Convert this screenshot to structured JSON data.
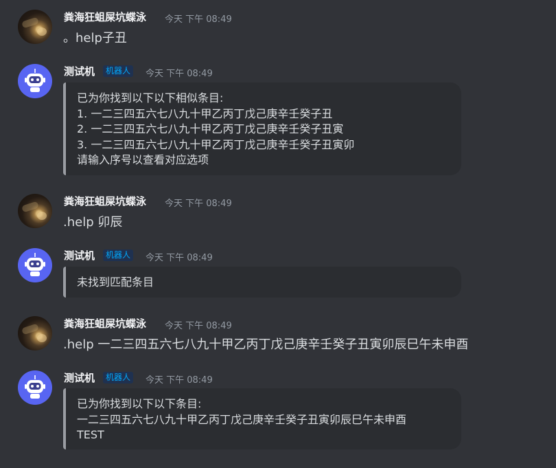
{
  "colors": {
    "background": "#313338",
    "embed_bg": "#2b2d31",
    "embed_border": "#9a9da3",
    "bot_avatar": "#5865f2",
    "bot_tag": "#00a8fc"
  },
  "messages": [
    {
      "author": "粪海狂蛆屎坑蝶泳",
      "avatar": "user-avatar",
      "timestamp": "今天 下午 08:49",
      "content": "。help子丑"
    },
    {
      "author": "测试机",
      "avatar": "bot-icon",
      "tag": "机器人",
      "timestamp": "今天 下午 08:49",
      "embed_lines": [
        "已为你找到以下以下相似条目:",
        "1. 一二三四五六七八九十甲乙丙丁戊己庚辛壬癸子丑",
        "2. 一二三四五六七八九十甲乙丙丁戊己庚辛壬癸子丑寅",
        "3. 一二三四五六七八九十甲乙丙丁戊己庚辛壬癸子丑寅卯",
        "请输入序号以查看对应选项"
      ]
    },
    {
      "author": "粪海狂蛆屎坑蝶泳",
      "avatar": "user-avatar",
      "timestamp": "今天 下午 08:49",
      "content": ".help 卯辰"
    },
    {
      "author": "测试机",
      "avatar": "bot-icon",
      "tag": "机器人",
      "timestamp": "今天 下午 08:49",
      "embed_lines": [
        "未找到匹配条目"
      ]
    },
    {
      "author": "粪海狂蛆屎坑蝶泳",
      "avatar": "user-avatar",
      "timestamp": "今天 下午 08:49",
      "content": ".help 一二三四五六七八九十甲乙丙丁戊己庚辛壬癸子丑寅卯辰巳午未申酉"
    },
    {
      "author": "测试机",
      "avatar": "bot-icon",
      "tag": "机器人",
      "timestamp": "今天 下午 08:49",
      "embed_lines": [
        "已为你找到以下以下条目:",
        "一二三四五六七八九十甲乙丙丁戊己庚辛壬癸子丑寅卯辰巳午未申酉",
        "TEST"
      ]
    }
  ]
}
